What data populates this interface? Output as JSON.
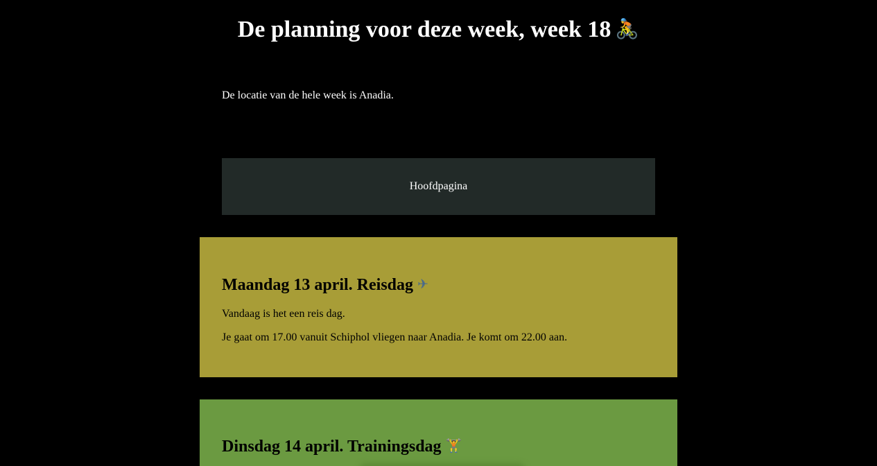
{
  "header": {
    "title": "De planning voor deze week, week 18",
    "title_icon": "woman-biking-icon"
  },
  "intro": {
    "location_text": "De locatie van de hele week is Anadia."
  },
  "nav": {
    "home_label": "Hoofdpagina"
  },
  "days": [
    {
      "heading": "Maandag 13 april. Reisdag",
      "icon": "airplane-icon",
      "paragraphs": [
        "Vandaag is het een reis dag.",
        "Je gaat om 17.00 vanuit Schiphol vliegen naar Anadia. Je komt om 22.00 aan."
      ],
      "background_color": "#a89d37"
    },
    {
      "heading": "Dinsdag 14 april. Trainingsdag",
      "icon": "weight-lifter-icon",
      "paragraphs": [],
      "background_color": "#6b9a41"
    }
  ],
  "colors": {
    "page_background": "#000000",
    "nav_background": "#222a28",
    "text_light": "#ffffff",
    "text_dark": "#000000"
  }
}
